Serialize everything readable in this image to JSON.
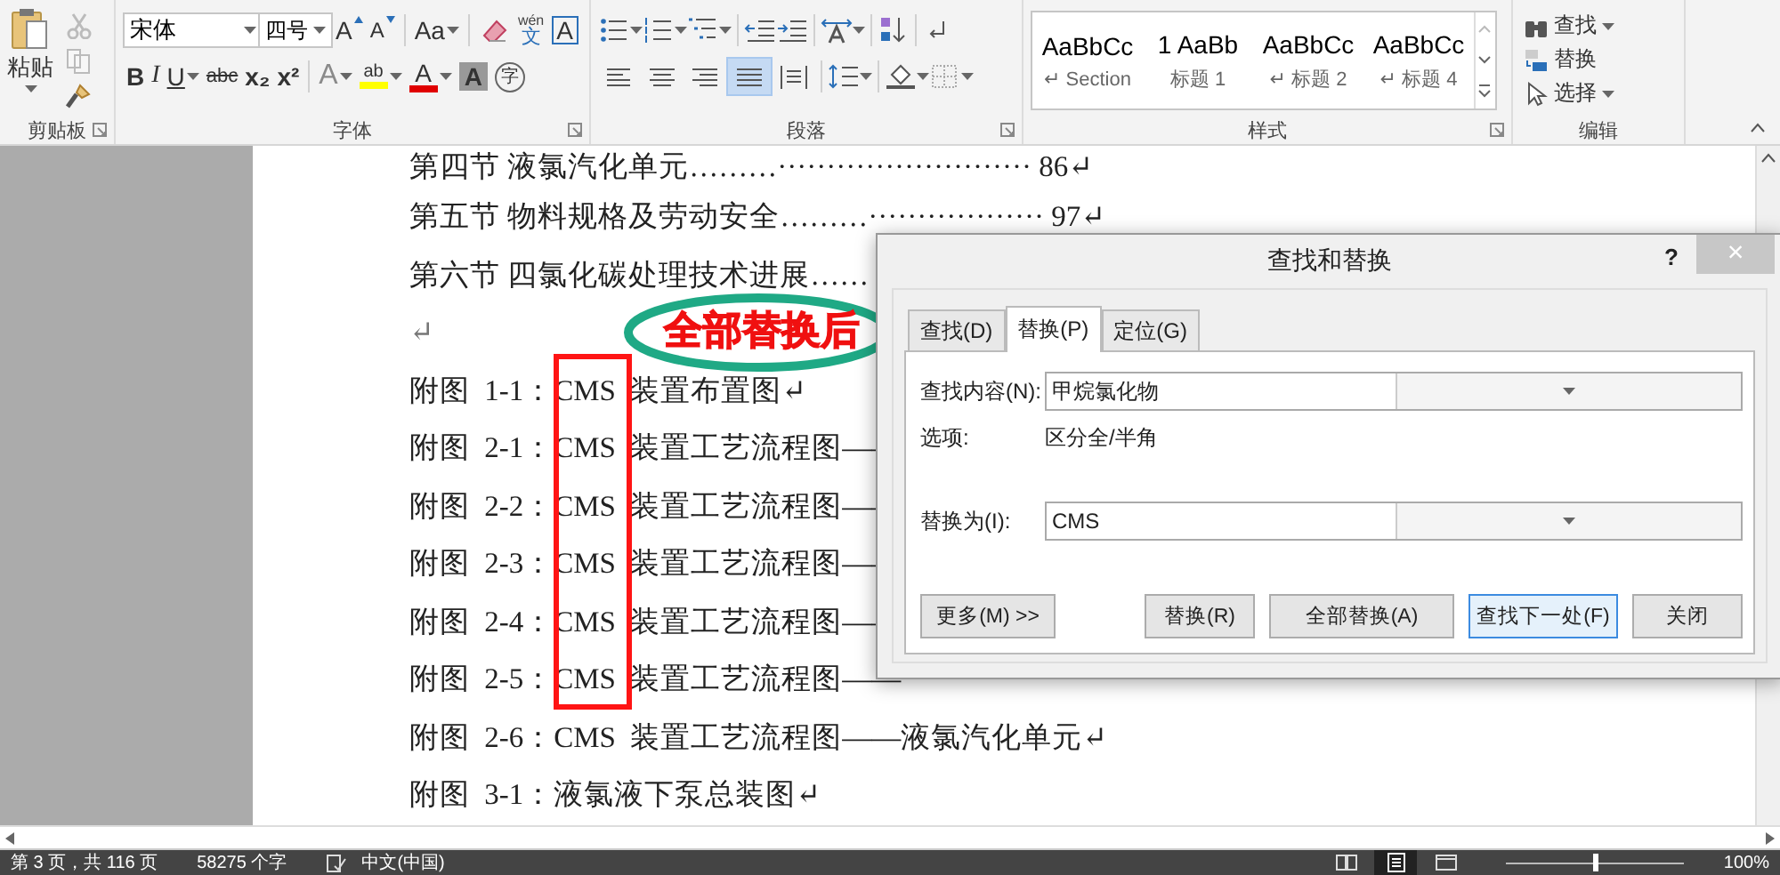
{
  "ribbon": {
    "clipboard": {
      "label": "剪贴板",
      "paste": "粘贴",
      "tools": [
        {
          "kind": "cut",
          "disabled": true
        },
        {
          "kind": "copy",
          "disabled": true
        },
        {
          "kind": "format_painter",
          "disabled": false
        }
      ]
    },
    "font": {
      "label": "字体",
      "font_name": "宋体",
      "font_size": "四号",
      "row1": [
        {
          "kind": "grow",
          "text": "A"
        },
        {
          "kind": "shrink",
          "text": "A"
        },
        {
          "kind": "case",
          "text": "Aa"
        },
        {
          "kind": "clear"
        },
        {
          "kind": "phonetic",
          "text": "wén",
          "base": "文"
        },
        {
          "kind": "border",
          "text": "A"
        }
      ],
      "row2": [
        {
          "kind": "bold",
          "text": "B"
        },
        {
          "kind": "italic",
          "text": "I"
        },
        {
          "kind": "underline",
          "text": "U"
        },
        {
          "kind": "strike",
          "text": "abc"
        },
        {
          "kind": "subscript",
          "text": "x₂"
        },
        {
          "kind": "superscript",
          "text": "x²"
        },
        {
          "kind": "effects",
          "text": "A"
        },
        {
          "kind": "highlight",
          "text": "ab"
        },
        {
          "kind": "color",
          "text": "A"
        },
        {
          "kind": "shading",
          "text": "A"
        },
        {
          "kind": "enclose",
          "text": "字"
        }
      ]
    },
    "paragraph": {
      "label": "段落",
      "alignment": [
        {
          "kind": "left",
          "selected": false
        },
        {
          "kind": "center",
          "selected": false
        },
        {
          "kind": "right",
          "selected": false
        },
        {
          "kind": "justify",
          "selected": true
        },
        {
          "kind": "distributed",
          "selected": false
        }
      ]
    },
    "styles": {
      "label": "样式",
      "items": [
        {
          "preview": "AaBbCc",
          "name": "↵ Section"
        },
        {
          "preview": "1  AaBb",
          "name": "标题 1"
        },
        {
          "preview": "AaBbCc",
          "name": "↵ 标题 2"
        },
        {
          "preview": "AaBbCc",
          "name": "↵ 标题 4"
        }
      ]
    },
    "editing": {
      "label": "编辑",
      "items": [
        {
          "kind": "find",
          "label": "查找"
        },
        {
          "kind": "replace",
          "label": "替换"
        },
        {
          "kind": "select",
          "label": "选择"
        }
      ]
    }
  },
  "document": {
    "lines": [
      {
        "kind": "toc",
        "text": "第四节  液氯汽化单元………··························  86↵"
      },
      {
        "kind": "toc",
        "text": "第五节  物料规格及劳动安全………··················  97↵"
      },
      {
        "kind": "toc",
        "text": "第六节  四氯化碳处理技术进展……"
      },
      {
        "kind": "blank",
        "text": "↵"
      },
      {
        "kind": "figure",
        "text": "附图 1-1：CMS 装置布置图↵"
      },
      {
        "kind": "figure",
        "text": "附图 2-1：CMS 装置工艺流程图——"
      },
      {
        "kind": "figure",
        "text": "附图 2-2：CMS 装置工艺流程图——"
      },
      {
        "kind": "figure",
        "text": "附图 2-3：CMS 装置工艺流程图——"
      },
      {
        "kind": "figure",
        "text": "附图 2-4：CMS 装置工艺流程图——"
      },
      {
        "kind": "figure",
        "text": "附图 2-5：CMS 装置工艺流程图——"
      },
      {
        "kind": "figure",
        "text": "附图 2-6：CMS 装置工艺流程图——液氯汽化单元↵"
      },
      {
        "kind": "figure",
        "text": "附图 3-1：液氯液下泵总装图↵"
      }
    ],
    "annotation": {
      "text": "全部替换后"
    }
  },
  "dialog": {
    "title": "查找和替换",
    "help": "?",
    "close": "×",
    "tabs": [
      {
        "label": "查找(D)",
        "selected": false
      },
      {
        "label": "替换(P)",
        "selected": true
      },
      {
        "label": "定位(G)",
        "selected": false
      }
    ],
    "find_label": "查找内容(N):",
    "find_value": "甲烷氯化物",
    "options_label": "选项:",
    "options_value": "区分全/半角",
    "replace_label": "替换为(I):",
    "replace_value": "CMS",
    "buttons": [
      {
        "label": "更多(M) >>",
        "focused": false
      },
      {
        "label": "替换(R)",
        "focused": false
      },
      {
        "label": "全部替换(A)",
        "focused": false
      },
      {
        "label": "查找下一处(F)",
        "focused": true
      },
      {
        "label": "关闭",
        "focused": false
      }
    ]
  },
  "status_bar": {
    "page": "第 3 页，共 116 页",
    "words": "58275 个字",
    "language": "中文(中国)",
    "views": [
      {
        "selected": false
      },
      {
        "selected": true
      },
      {
        "selected": false
      }
    ],
    "zoom_slider": {
      "level": 0.5
    },
    "zoom": "100%"
  }
}
